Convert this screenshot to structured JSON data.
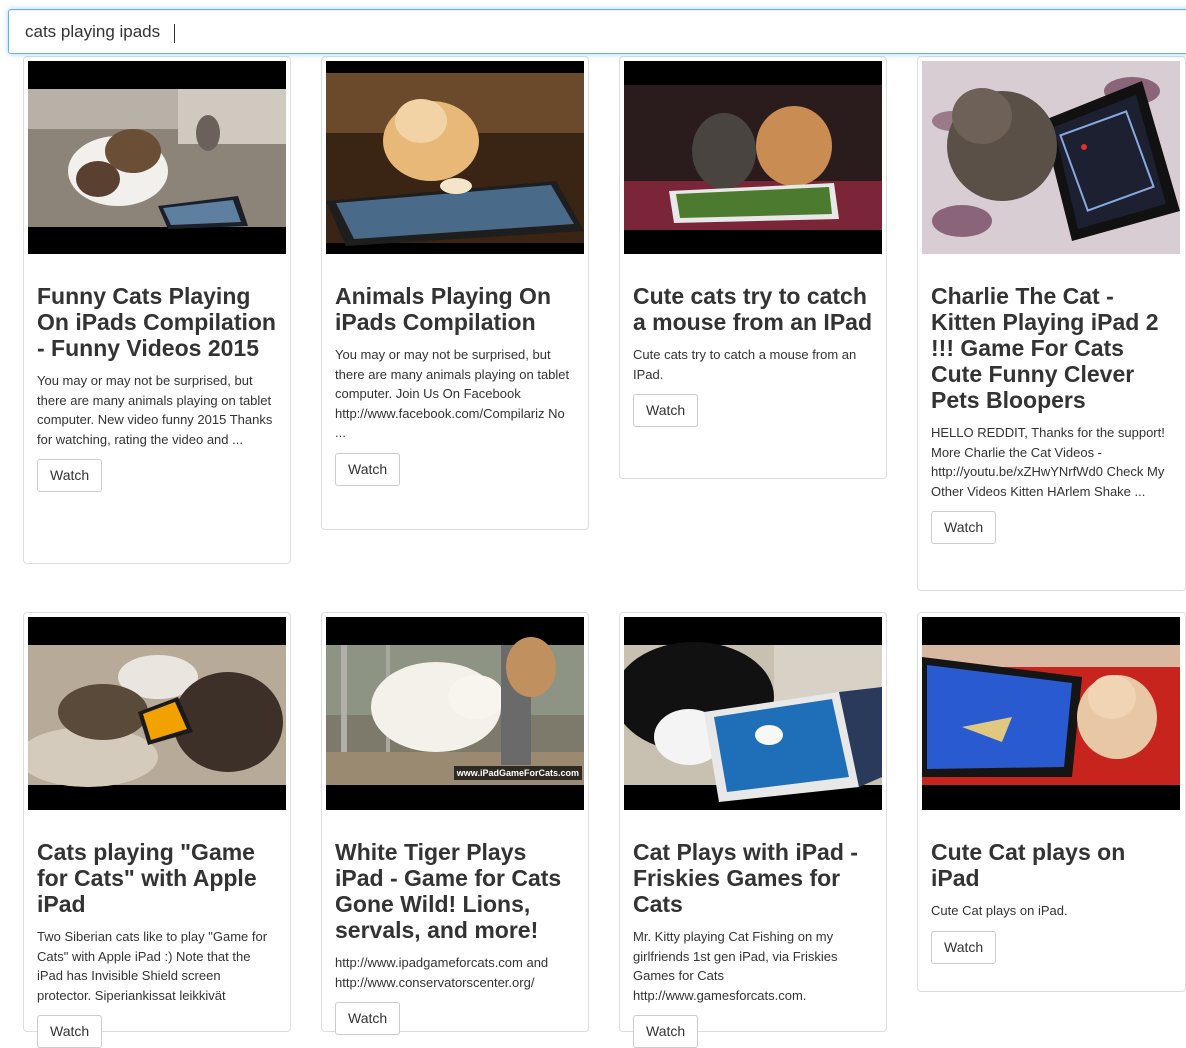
{
  "search": {
    "value": "cats playing ipads",
    "placeholder": ""
  },
  "results": [
    {
      "title": "Funny Cats Playing On iPads Compilation - Funny Videos 2015",
      "description": "You may or may not be surprised, but there are many animals playing on tablet computer. New video funny 2015 Thanks for watching, rating the video and ...",
      "button": "Watch"
    },
    {
      "title": "Animals Playing On iPads Compilation",
      "description": "You may or may not be surprised, but there are many animals playing on tablet computer. Join Us On Facebook http://www.facebook.com/Compilariz No ...",
      "button": "Watch"
    },
    {
      "title": "Cute cats try to catch a mouse from an IPad",
      "description": "Cute cats try to catch a mouse from an IPad.",
      "button": "Watch"
    },
    {
      "title": "Charlie The Cat - Kitten Playing iPad 2 !!! Game For Cats Cute Funny Clever Pets Bloopers",
      "description": "HELLO REDDIT, Thanks for the support! More Charlie the Cat Videos - http://youtu.be/xZHwYNrfWd0 Check My Other Videos Kitten HArlem Shake ...",
      "button": "Watch"
    },
    {
      "title": "Cats playing \"Game for Cats\" with Apple iPad",
      "description": "Two Siberian cats like to play \"Game for Cats\" with Apple iPad :) Note that the iPad has Invisible Shield screen protector. Siperiankissat leikkivät",
      "button": "Watch"
    },
    {
      "title": "White Tiger Plays iPad - Game for Cats Gone Wild! Lions, servals, and more!",
      "description": "http://www.ipadgameforcats.com and http://www.conservatorscenter.org/",
      "button": "Watch",
      "watermark": "www.iPadGameForCats.com"
    },
    {
      "title": "Cat Plays with iPad - Friskies Games for Cats",
      "description": "Mr. Kitty playing Cat Fishing on my girlfriends 1st gen iPad, via Friskies Games for Cats http://www.gamesforcats.com.",
      "button": "Watch"
    },
    {
      "title": "Cute Cat plays on iPad",
      "description": "Cute Cat plays on iPad.",
      "button": "Watch"
    }
  ]
}
